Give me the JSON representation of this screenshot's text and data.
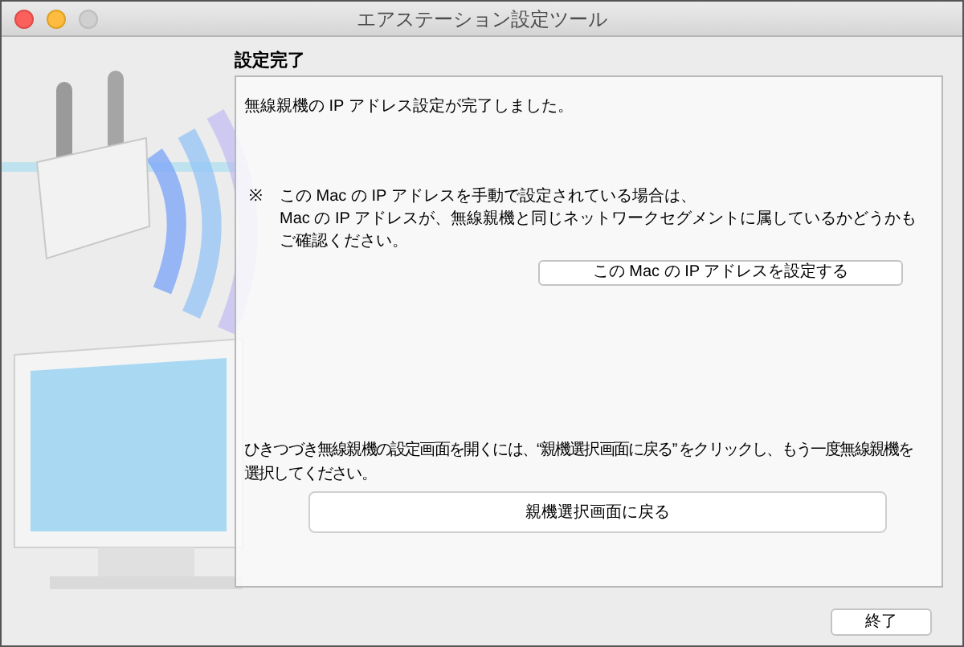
{
  "window": {
    "title": "エアステーション設定ツール"
  },
  "heading": "設定完了",
  "message": "無線親機の IP アドレス設定が完了しました。",
  "note": {
    "mark": "※",
    "lines": [
      "この Mac の IP アドレスを手動で設定されている場合は、",
      "Mac の IP アドレスが、無線親機と同じネットワークセグメントに属しているかどうかも",
      "ご確認ください。"
    ]
  },
  "set_ip_button": "この Mac の IP アドレスを設定する",
  "instruction": {
    "lines": [
      "ひきつづき無線親機の設定画面を開くには、“親機選択画面に戻る” をクリックし、もう一度無線親機を",
      "選択してください。"
    ]
  },
  "back_button": "親機選択画面に戻る",
  "quit_button": "終了"
}
